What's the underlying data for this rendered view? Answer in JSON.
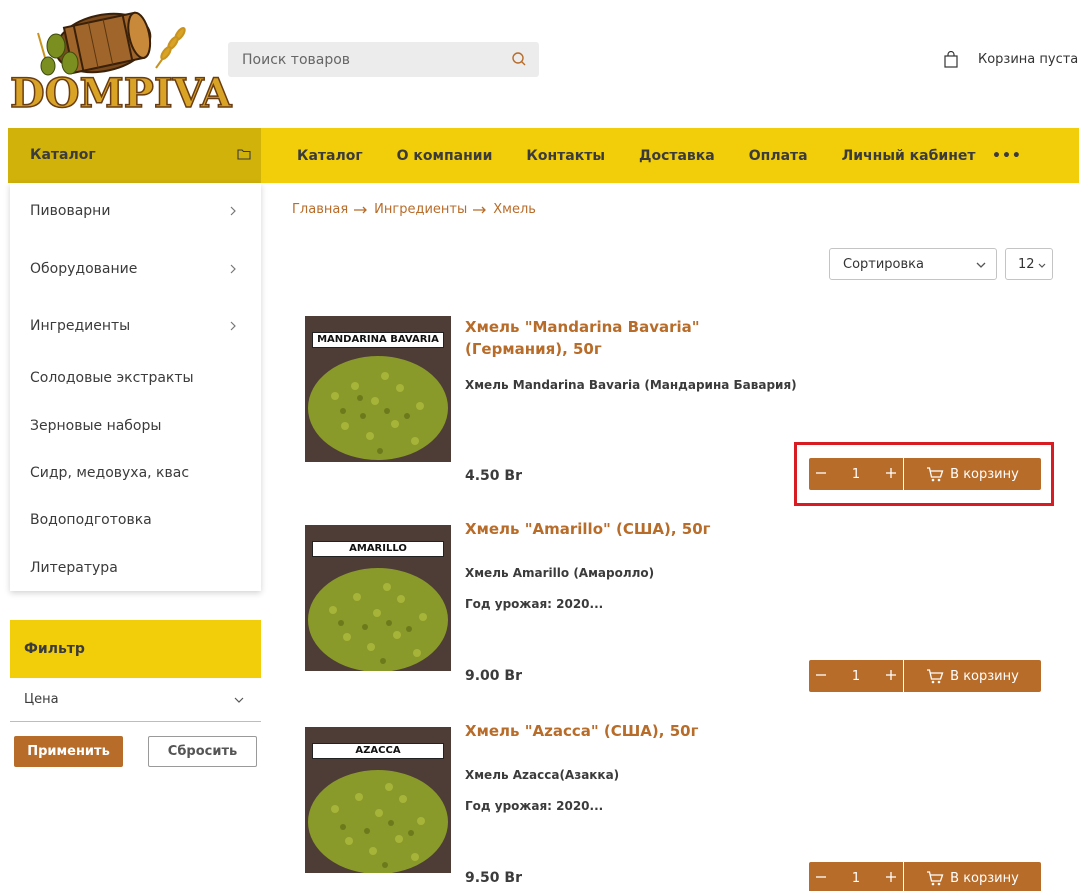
{
  "brand": {
    "logo_text": "DOMPIVA"
  },
  "search": {
    "placeholder": "Поиск товаров"
  },
  "cart": {
    "status": "Корзина пуста"
  },
  "catalog_button": {
    "label": "Каталог"
  },
  "nav": {
    "items": [
      "Каталог",
      "О компании",
      "Контакты",
      "Доставка",
      "Оплата",
      "Личный кабинет"
    ],
    "more": "•••"
  },
  "sidebar": {
    "items": [
      {
        "label": "Пивоварни",
        "has_children": true
      },
      {
        "label": "Оборудование",
        "has_children": true
      },
      {
        "label": "Ингредиенты",
        "has_children": true
      },
      {
        "label": "Солодовые экстракты",
        "has_children": false
      },
      {
        "label": "Зерновые наборы",
        "has_children": false
      },
      {
        "label": "Сидр, медовуха, квас",
        "has_children": false
      },
      {
        "label": "Водоподготовка",
        "has_children": false
      },
      {
        "label": "Литература",
        "has_children": false
      }
    ]
  },
  "filter": {
    "title": "Фильтр",
    "price_label": "Цена",
    "apply_label": "Применить",
    "reset_label": "Сбросить"
  },
  "breadcrumb": [
    "Главная",
    "Ингредиенты",
    "Хмель"
  ],
  "sorting": {
    "sort_label": "Сортировка",
    "per_page": "12"
  },
  "products": [
    {
      "title": "Хмель \"Mandarina Bavaria\" (Германия), 50г",
      "image_label": "MANDARINA BAVARIA",
      "desc1": "Хмель Mandarina Bavaria (Мандарина Бавария)",
      "desc2": "",
      "price": "4.50 Br",
      "qty": "1",
      "add_label": "В корзину"
    },
    {
      "title": "Хмель \"Amarillo\" (США), 50г",
      "image_label": "AMARILLO",
      "desc1": "Хмель Amarillo (Амаролло)",
      "desc2": "Год урожая: 2020...",
      "price": "9.00 Br",
      "qty": "1",
      "add_label": "В корзину"
    },
    {
      "title": "Хмель \"Azacca\" (США), 50г",
      "image_label": "AZACCA",
      "desc1": "Хмель Azacca(Азакка)",
      "desc2": "Год урожая: 2020...",
      "price": "9.50 Br",
      "qty": "1",
      "add_label": "В корзину"
    }
  ],
  "colors": {
    "accent_yellow": "#f2ce0a",
    "catalog_yellow": "#d1b20a",
    "brown": "#b86c2a",
    "highlight_red": "#d71c24"
  }
}
